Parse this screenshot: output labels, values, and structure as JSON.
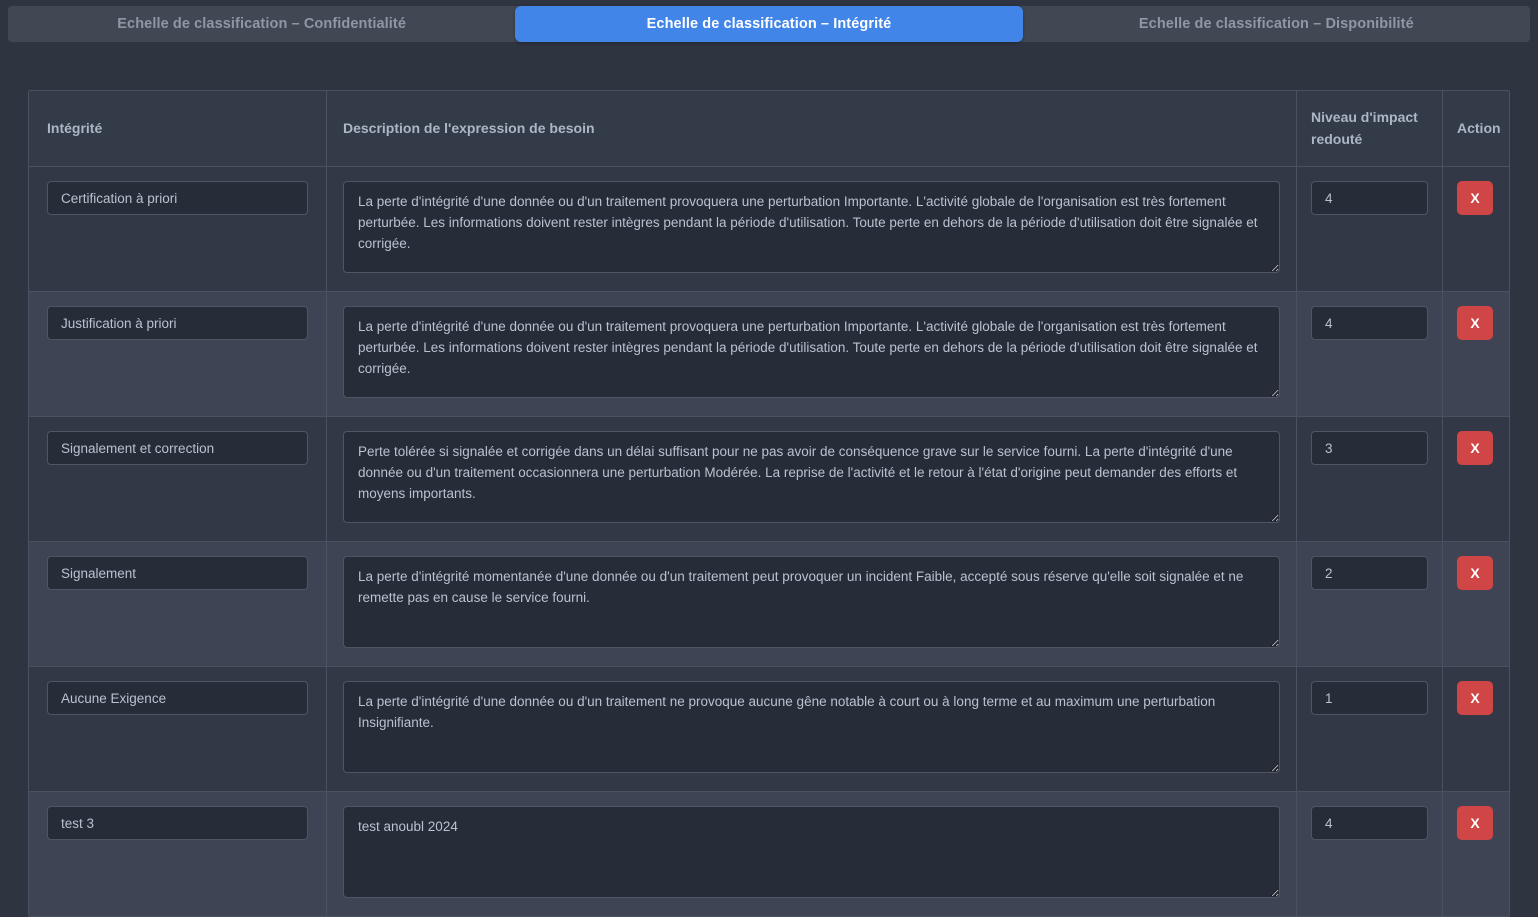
{
  "tabs": [
    {
      "label": "Echelle de classification – Confidentialité",
      "active": false
    },
    {
      "label": "Echelle de classification – Intégrité",
      "active": true
    },
    {
      "label": "Echelle de classification – Disponibilité",
      "active": false
    }
  ],
  "table": {
    "headers": {
      "name": "Intégrité",
      "description": "Description de l'expression de besoin",
      "level": "Niveau d'impact redouté",
      "action": "Action"
    },
    "delete_label": "X",
    "rows": [
      {
        "name": "Certification à priori",
        "description": "La perte d'intégrité d'une donnée ou d'un traitement provoquera une perturbation Importante. L'activité globale de l'organisation est très fortement perturbée. Les informations doivent rester intègres pendant la période d'utilisation. Toute perte en dehors de la période d'utilisation doit être signalée et corrigée.",
        "level": "4"
      },
      {
        "name": "Justification à priori",
        "description": "La perte d'intégrité d'une donnée ou d'un traitement provoquera une perturbation Importante. L'activité globale de l'organisation est très fortement perturbée. Les informations doivent rester intègres pendant la période d'utilisation. Toute perte en dehors de la période d'utilisation doit être signalée et corrigée.",
        "level": "4"
      },
      {
        "name": "Signalement et correction",
        "description": "Perte tolérée si signalée et corrigée dans un délai suffisant pour ne pas avoir de conséquence grave sur le service fourni. La perte d'intégrité d'une donnée ou d'un traitement occasionnera une perturbation Modérée. La reprise de l'activité et le retour à l'état d'origine peut demander des efforts et moyens importants.",
        "level": "3"
      },
      {
        "name": "Signalement",
        "description": "La perte d'intégrité momentanée d'une donnée ou d'un traitement peut provoquer un incident Faible, accepté sous réserve qu'elle soit signalée et ne remette pas en cause le service fourni.",
        "level": "2"
      },
      {
        "name": "Aucune Exigence",
        "description": "La perte d'intégrité d'une donnée ou d'un traitement ne provoque aucune gêne notable à court ou à long terme et au maximum une perturbation Insignifiante.",
        "level": "1"
      },
      {
        "name": "test 3",
        "description": "test anoubl 2024",
        "level": "4"
      }
    ]
  },
  "colors": {
    "page_bg": "#2e3440",
    "tabbar_bg": "#414753",
    "tab_active": "#4285e8",
    "row_odd": "#323846",
    "row_even": "#3e4453",
    "field_bg": "#262c38",
    "border": "#4a5160",
    "delete_red": "#d04545"
  }
}
